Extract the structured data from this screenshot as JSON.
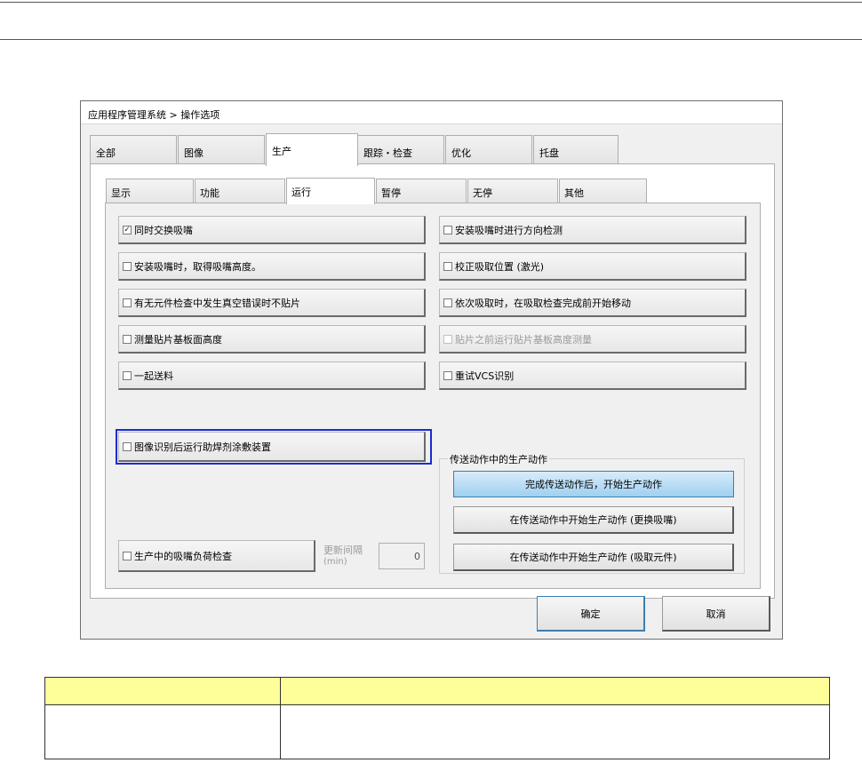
{
  "window": {
    "title": "应用程序管理系统 > 操作选项"
  },
  "tabs": [
    "全部",
    "图像",
    "生产",
    "跟踪・检查",
    "优化",
    "托盘"
  ],
  "active_tab": "生产",
  "subtabs": [
    "显示",
    "功能",
    "运行",
    "暂停",
    "无停",
    "其他"
  ],
  "active_subtab": "运行",
  "options_left": [
    {
      "label": "同时交换吸嘴",
      "checked": true
    },
    {
      "label": "安装吸嘴时，取得吸嘴高度。",
      "checked": false
    },
    {
      "label": "有无元件检查中发生真空错误时不贴片",
      "checked": false
    },
    {
      "label": "测量贴片基板面高度",
      "checked": false
    },
    {
      "label": "一起送料",
      "checked": false
    }
  ],
  "options_right": [
    {
      "label": "安装吸嘴时进行方向检测",
      "checked": false
    },
    {
      "label": "校正吸取位置 (激光)",
      "checked": false
    },
    {
      "label": "依次吸取时，在吸取检查完成前开始移动",
      "checked": false
    },
    {
      "label": "贴片之前运行贴片基板高度测量",
      "checked": false,
      "disabled": true
    },
    {
      "label": "重试VCS识别",
      "checked": false
    }
  ],
  "highlighted_option": {
    "label": "图像识别后运行助焊剂涂敷装置",
    "checked": false
  },
  "group": {
    "title": "传送动作中的生产动作",
    "buttons": [
      "完成传送动作后，开始生产动作",
      "在传送动作中开始生产动作 (更换吸嘴)",
      "在传送动作中开始生产动作 (吸取元件)"
    ]
  },
  "load_check": {
    "label": "生产中的吸嘴负荷检查",
    "checked": false
  },
  "interval": {
    "label_line1": "更新间隔",
    "label_line2": "(min)",
    "value": "0"
  },
  "footer": {
    "ok": "确定",
    "cancel": "取消"
  },
  "table": {
    "header": [
      "",
      ""
    ],
    "row": [
      "",
      ""
    ]
  },
  "colors": {
    "highlight_border": "#1c2bd0",
    "table_header": "#ffff99",
    "selected_button": "#9fd0f0"
  }
}
